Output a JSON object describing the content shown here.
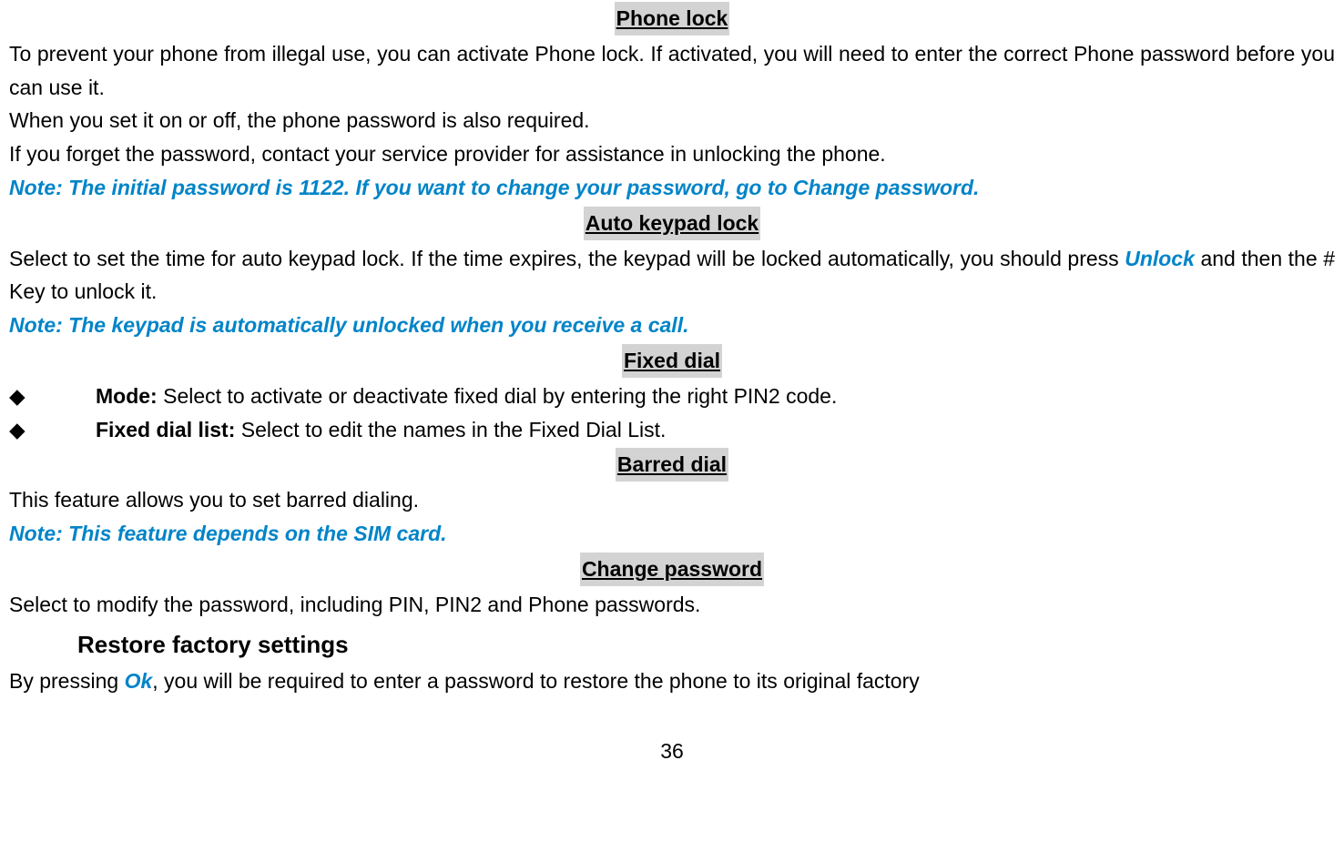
{
  "phone_lock": {
    "heading": "Phone lock",
    "p1": "To prevent your phone from illegal use, you can activate Phone lock. If activated, you will need to enter the correct Phone password before you can use it.",
    "p2": "When you set it on or off, the phone password is also required.",
    "p3": "If you forget the password, contact your service provider for assistance in unlocking the phone.",
    "note": "Note: The initial password is 1122. If you want to change your password, go to Change password."
  },
  "auto_keypad": {
    "heading": "Auto keypad lock",
    "p1_a": "Select to set the time for auto keypad lock. If the time expires, the keypad will be locked automatically, you should press ",
    "p1_b_highlight": "Unlock",
    "p1_c": " and then the # Key to unlock it.",
    "note": "Note: The keypad is automatically unlocked when you receive a call."
  },
  "fixed_dial": {
    "heading": "Fixed dial",
    "bullets": [
      {
        "label": "Mode:",
        "text": " Select to activate or deactivate fixed dial by entering the right PIN2 code."
      },
      {
        "label": "Fixed dial list:",
        "text": " Select to edit the names in the Fixed Dial List."
      }
    ]
  },
  "barred_dial": {
    "heading": "Barred dial",
    "p1": "This feature allows you to set barred dialing.",
    "note": "Note: This feature depends on the SIM card."
  },
  "change_password": {
    "heading": "Change password",
    "p1": "Select to modify the password, including PIN, PIN2 and Phone passwords."
  },
  "restore": {
    "heading": "Restore factory settings",
    "p1_a": "By pressing ",
    "p1_b_highlight": "Ok",
    "p1_c": ", you will be required to enter a password to restore the phone to its original factory"
  },
  "page_number": "36",
  "bullet_symbol": "◆"
}
